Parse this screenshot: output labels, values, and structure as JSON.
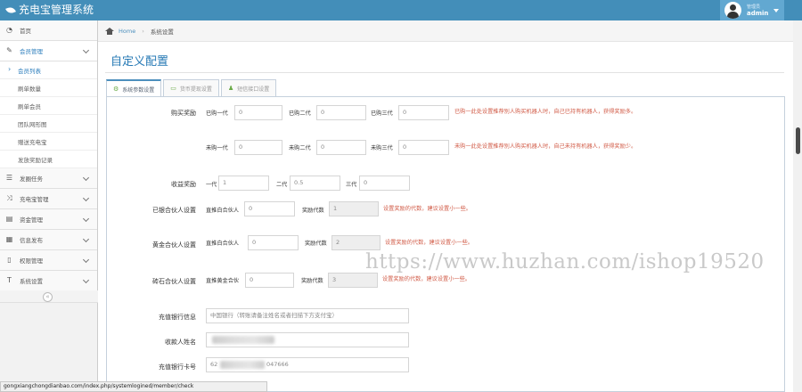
{
  "app": {
    "title": "充电宝管理系统"
  },
  "user": {
    "role": "管理员",
    "name": "admin"
  },
  "sidebar": {
    "items": [
      {
        "label": "首页",
        "icon": "tachometer-icon"
      },
      {
        "label": "会员管理",
        "icon": "edit-icon"
      },
      {
        "label": "会员列表",
        "active": true
      },
      {
        "label": "刷单数量"
      },
      {
        "label": "刷单会员"
      },
      {
        "label": "团队网形图"
      },
      {
        "label": "赠送充电宝"
      },
      {
        "label": "发放奖励记录"
      },
      {
        "label": "发圈任务",
        "icon": "list-icon"
      },
      {
        "label": "充电宝管理",
        "icon": "shuffle-icon"
      },
      {
        "label": "资金管理",
        "icon": "bookmark-icon"
      },
      {
        "label": "信息发布",
        "icon": "calendar-icon"
      },
      {
        "label": "权限管理",
        "icon": "file-icon"
      },
      {
        "label": "系统设置",
        "icon": "text-height-icon"
      }
    ],
    "collapse_label": "«"
  },
  "breadcrumb": {
    "home": "Home",
    "current": "系统设置"
  },
  "page": {
    "title": "自定义配置"
  },
  "tabs": [
    {
      "label": "系统参数设置",
      "icon": "cogs-icon",
      "active": true
    },
    {
      "label": "货币提现设置",
      "icon": "money-icon"
    },
    {
      "label": "短信接口设置",
      "icon": "user-icon"
    }
  ],
  "form": {
    "purchase_reward": {
      "label": "购买奖励",
      "row1": {
        "gen1": "已购一代",
        "v1": "0",
        "gen2": "已购二代",
        "v2": "0",
        "gen3": "已购三代",
        "v3": "0",
        "hint": "已购一此处设置推荐别人购买机器人时，自己已持有机器人，获得奖励多。"
      },
      "row2": {
        "gen1": "未购一代",
        "v1": "0",
        "gen2": "未购二代",
        "v2": "0",
        "gen3": "未购三代",
        "v3": "0",
        "hint": "未购一此处设置推荐别人购买机器人时，自己未持有机器人，获得奖励少。"
      }
    },
    "income_reward": {
      "label": "收益奖励",
      "gen1": "一代",
      "v1": "1",
      "gen2": "二代",
      "v2": "0.5",
      "gen3": "三代",
      "v3": "0"
    },
    "silver_partner": {
      "label": "已银合伙人设置",
      "direct": "直推白合伙人",
      "direct_v": "0",
      "gen": "奖励代数",
      "gen_v": "1",
      "hint": "设置奖励的代数，建议设置小一些。"
    },
    "gold_partner": {
      "label": "黄金合伙人设置",
      "direct": "直推白合伙人",
      "direct_v": "0",
      "gen": "奖励代数",
      "gen_v": "2",
      "hint": "设置奖励的代数，建议设置小一些。"
    },
    "diamond_partner": {
      "label": "砖石合伙人设置",
      "direct": "直推黄金合伙",
      "direct_v": "0",
      "gen": "奖励代数",
      "gen_v": "3",
      "hint": "设置奖励的代数，建议设置小一些。"
    },
    "bank_info": {
      "label": "充值银行信息",
      "placeholder": "中国银行（转账请备注姓名或者扫描下方支付宝）"
    },
    "payee_name": {
      "label": "收款人姓名"
    },
    "bank_card": {
      "label": "充值银行卡号",
      "prefix": "62",
      "suffix": "047666"
    }
  },
  "watermark": "https://www.huzhan.com/ishop19520",
  "statusbar": "gongxiangchongdianbao.com/index.php/systemlogined/member/check"
}
